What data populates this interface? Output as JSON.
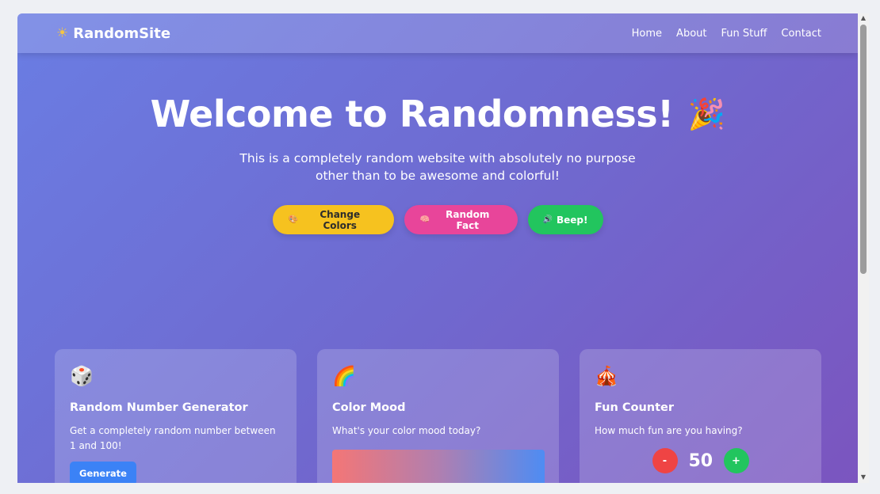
{
  "navbar": {
    "brand": "RandomSite",
    "brand_icon": "sun-icon",
    "links": [
      "Home",
      "About",
      "Fun Stuff",
      "Contact"
    ]
  },
  "hero": {
    "title": "Welcome to Randomness!",
    "title_icon": "party-popper-icon",
    "subtitle": "This is a completely random website with absolutely no purpose other than to be awesome and colorful!",
    "buttons": [
      {
        "label": "Change Colors",
        "icon": "palette-icon",
        "color": "#f6c21f"
      },
      {
        "label": "Random Fact",
        "icon": "brain-icon",
        "color": "#e8459a"
      },
      {
        "label": "Beep!",
        "icon": "speaker-icon",
        "color": "#22c55e"
      }
    ]
  },
  "cards": [
    {
      "icon": "dice-icon",
      "title": "Random Number Generator",
      "text": "Get a completely random number between 1 and 100!",
      "button": "Generate"
    },
    {
      "icon": "rainbow-icon",
      "title": "Color Mood",
      "text": "What's your color mood today?"
    },
    {
      "icon": "circus-tent-icon",
      "title": "Fun Counter",
      "text": "How much fun are you having?",
      "minus_label": "-",
      "plus_label": "+",
      "value": "50"
    }
  ],
  "colors": {
    "gradient_start": "#6a7de3",
    "gradient_end": "#7b55bf",
    "generate_button": "#3b82f6",
    "minus_button": "#ef4444",
    "plus_button": "#22c55e"
  }
}
